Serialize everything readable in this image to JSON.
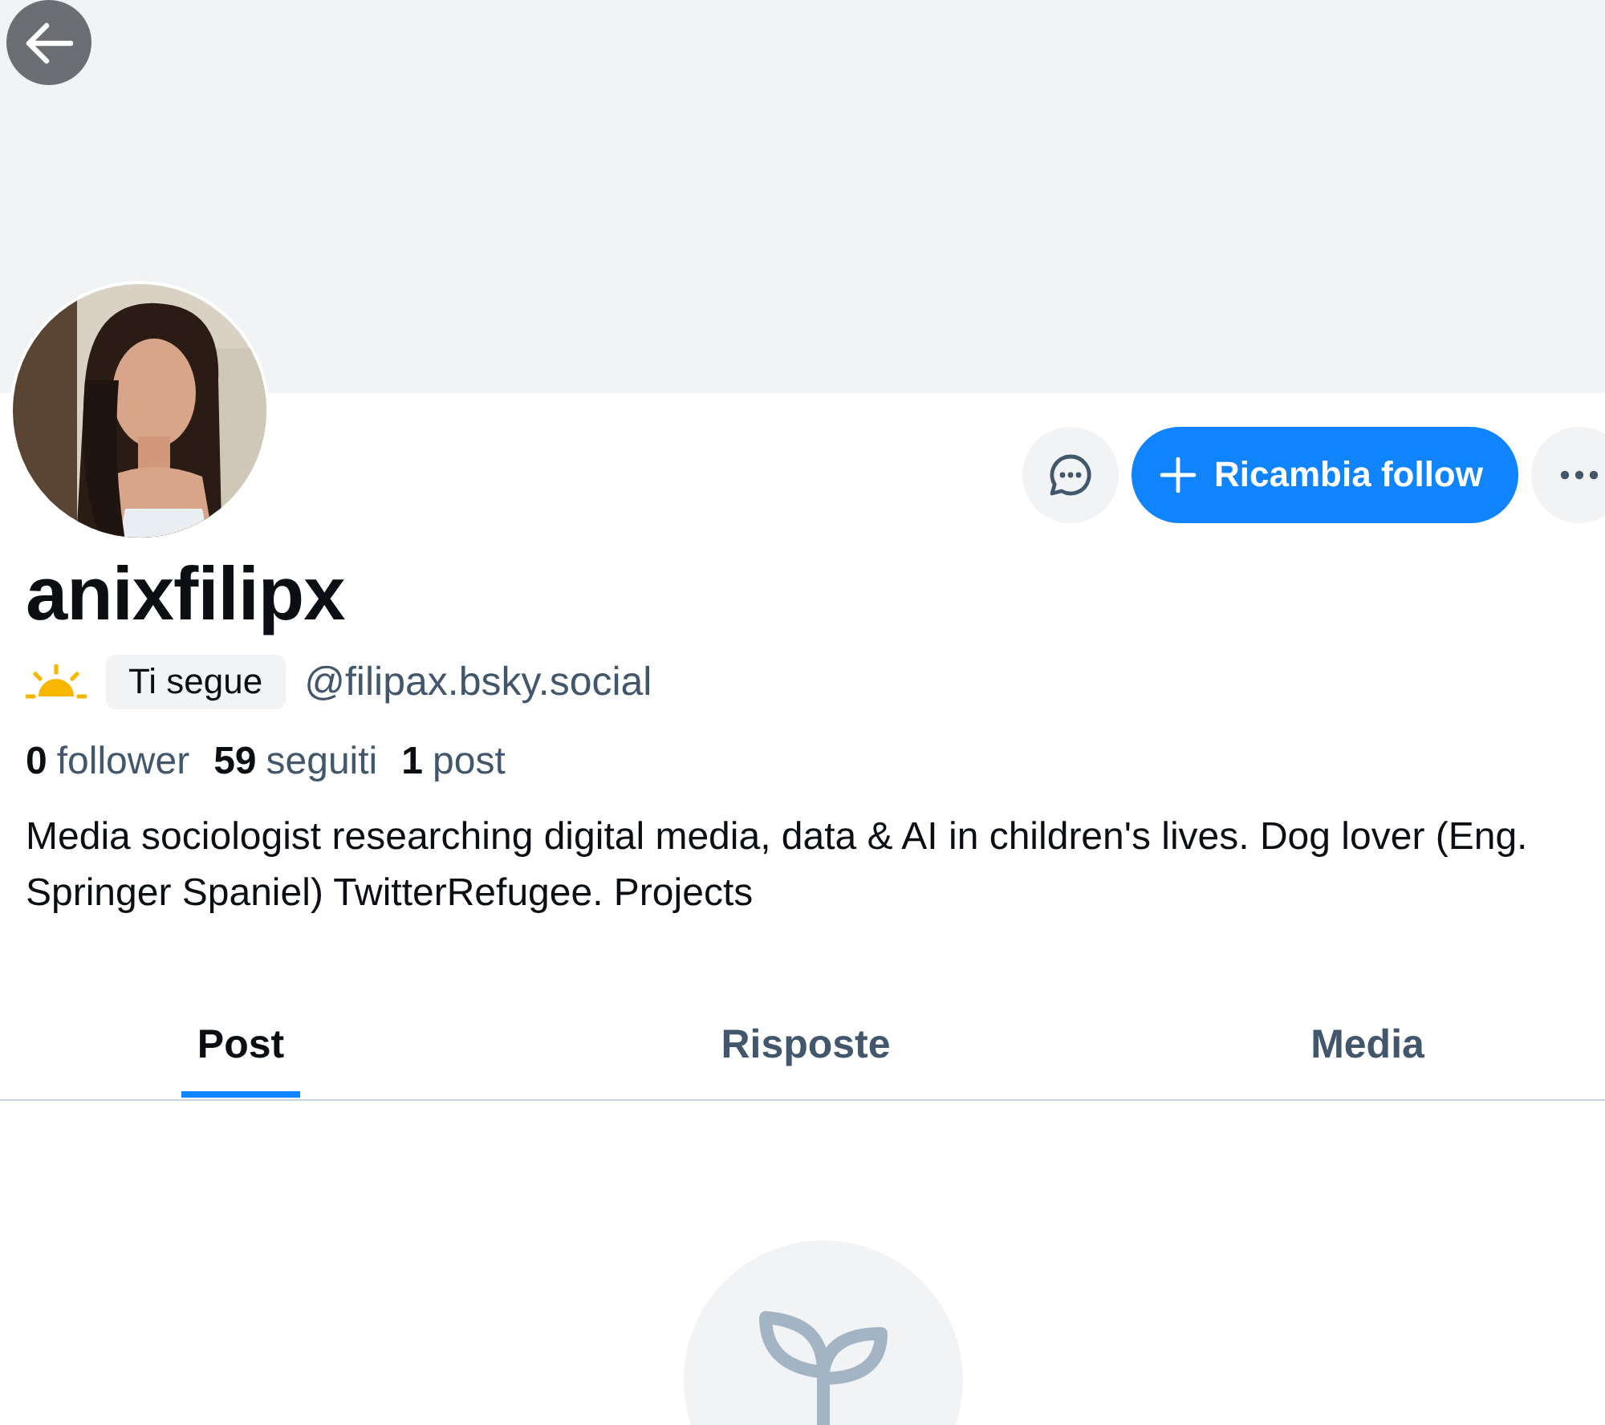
{
  "profile": {
    "display_name": "anixfilipx",
    "followed_badge": "Ti segue",
    "handle": "@filipax.bsky.social",
    "bio": "Media sociologist researching digital media, data & AI in children's lives. Dog lover (Eng. Springer Spaniel) TwitterRefugee. Projects"
  },
  "actions": {
    "follow_button": "Ricambia follow"
  },
  "stats": [
    {
      "count": "0",
      "label": "follower"
    },
    {
      "count": "59",
      "label": "seguiti"
    },
    {
      "count": "1",
      "label": "post"
    }
  ],
  "tabs": [
    {
      "label": "Post",
      "selected": true
    },
    {
      "label": "Risposte",
      "selected": false
    },
    {
      "label": "Media",
      "selected": false
    }
  ]
}
